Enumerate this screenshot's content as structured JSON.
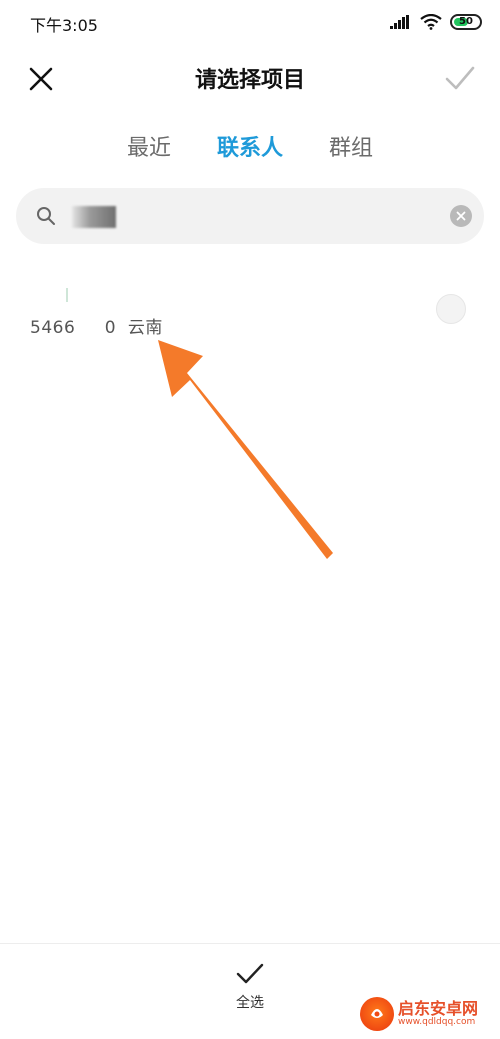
{
  "status_bar": {
    "time": "下午3:05",
    "battery": "50"
  },
  "header": {
    "title": "请选择项目",
    "close_icon": "close-icon",
    "confirm_icon": "check-icon"
  },
  "tabs": [
    {
      "label": "最近",
      "active": false
    },
    {
      "label": "联系人",
      "active": true
    },
    {
      "label": "群组",
      "active": false
    }
  ],
  "search": {
    "value": "",
    "placeholder": ""
  },
  "results": [
    {
      "text": "5466     0  云南"
    }
  ],
  "bottom_bar": {
    "select_all_label": "全选"
  },
  "watermark": {
    "title": "启东安卓网",
    "url": "www.qdldqq.com"
  },
  "colors": {
    "accent": "#1e9ad9",
    "arrow": "#f47a2a",
    "battery": "#22c45e"
  }
}
